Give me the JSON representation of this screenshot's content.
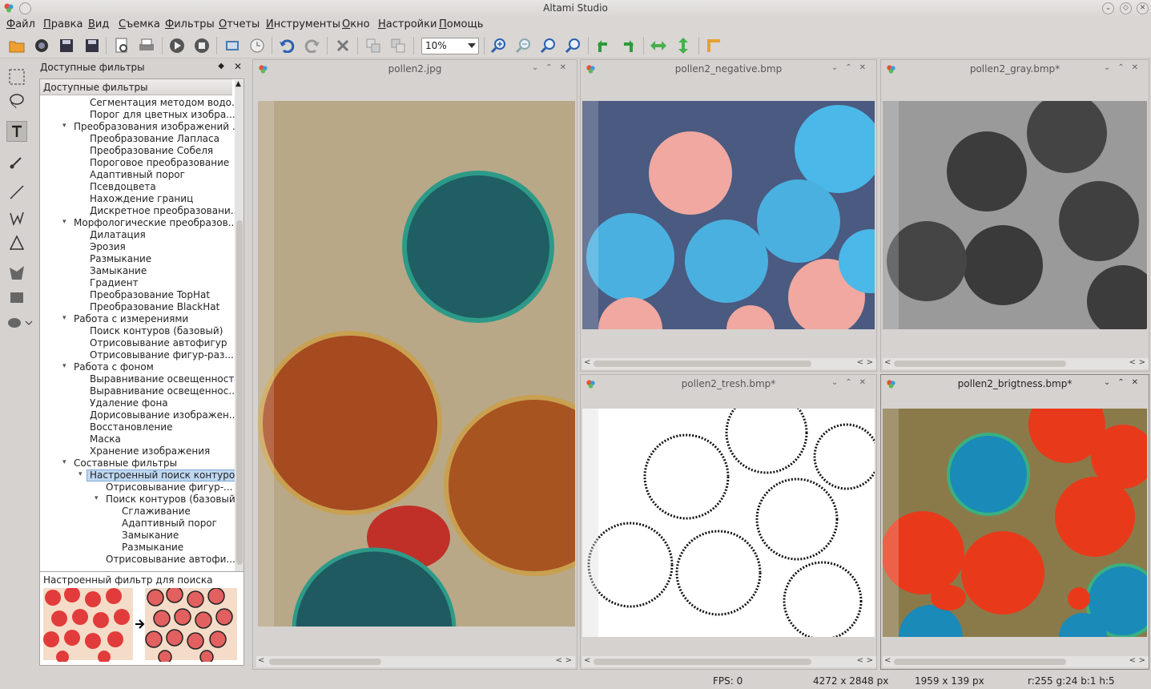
{
  "window": {
    "title": "Altami Studio"
  },
  "menu": [
    "Файл",
    "Правка",
    "Вид",
    "Съемка",
    "Фильтры",
    "Отчеты",
    "Инструменты",
    "Окно",
    "Настройки",
    "Помощь"
  ],
  "toolbar": {
    "zoom_value": "10%"
  },
  "dock": {
    "title": "Доступные фильтры",
    "tree_header": "Доступные фильтры",
    "items": [
      {
        "label": "Сегментация методом водо...",
        "level": 2
      },
      {
        "label": "Порог для цветных изобра...",
        "level": 2
      },
      {
        "label": "Преобразования изображений ...",
        "level": 1,
        "open": true
      },
      {
        "label": "Преобразование Лапласа",
        "level": 2
      },
      {
        "label": "Преобразование Собеля",
        "level": 2
      },
      {
        "label": "Пороговое преобразование",
        "level": 2
      },
      {
        "label": "Адаптивный порог",
        "level": 2
      },
      {
        "label": "Псевдоцвета",
        "level": 2
      },
      {
        "label": "Нахождение границ",
        "level": 2
      },
      {
        "label": "Дискретное преобразовани...",
        "level": 2
      },
      {
        "label": "Морфологические преобразов...",
        "level": 1,
        "open": true
      },
      {
        "label": "Дилатация",
        "level": 2
      },
      {
        "label": "Эрозия",
        "level": 2
      },
      {
        "label": "Размыкание",
        "level": 2
      },
      {
        "label": "Замыкание",
        "level": 2
      },
      {
        "label": "Градиент",
        "level": 2
      },
      {
        "label": "Преобразование TopHat",
        "level": 2
      },
      {
        "label": "Преобразование BlackHat",
        "level": 2
      },
      {
        "label": "Работа с измерениями",
        "level": 1,
        "open": true
      },
      {
        "label": "Поиск контуров (базовый)",
        "level": 2
      },
      {
        "label": "Отрисовывание автофигур",
        "level": 2
      },
      {
        "label": "Отрисовывание  фигур-раз...",
        "level": 2
      },
      {
        "label": "Работа с фоном",
        "level": 1,
        "open": true
      },
      {
        "label": "Выравнивание освещенности",
        "level": 2
      },
      {
        "label": "Выравнивание освещеннос...",
        "level": 2
      },
      {
        "label": "Удаление фона",
        "level": 2
      },
      {
        "label": "Дорисовывание изображен...",
        "level": 2
      },
      {
        "label": "Восстановление",
        "level": 2
      },
      {
        "label": "Маска",
        "level": 2
      },
      {
        "label": "Хранение изображения",
        "level": 2
      },
      {
        "label": "Составные фильтры",
        "level": 1,
        "open": true
      },
      {
        "label": "Настроенный поиск контуров",
        "level": 2,
        "open": true,
        "selected": true
      },
      {
        "label": "Отрисовывание  фигур-...",
        "level": 3
      },
      {
        "label": "Поиск контуров (базовый)",
        "level": 3,
        "open": true
      },
      {
        "label": "Сглаживание",
        "level": 4
      },
      {
        "label": "Адаптивный порог",
        "level": 4
      },
      {
        "label": "Замыкание",
        "level": 4
      },
      {
        "label": "Размыкание",
        "level": 4
      },
      {
        "label": "Отрисовывание автофи...",
        "level": 3
      }
    ],
    "preview_caption": "Настроенный фильтр для поиска контуров."
  },
  "windows": [
    {
      "title": "pollen2.jpg"
    },
    {
      "title": "pollen2_negative.bmp"
    },
    {
      "title": "pollen2_gray.bmp*"
    },
    {
      "title": "pollen2_tresh.bmp*"
    },
    {
      "title": "pollen2_brigtness.bmp*"
    }
  ],
  "status": {
    "fps": "FPS: 0",
    "size1": "4272 x 2848 px",
    "size2": "1959 x 139 px",
    "pixel": "r:255 g:24 b:1 h:5"
  }
}
